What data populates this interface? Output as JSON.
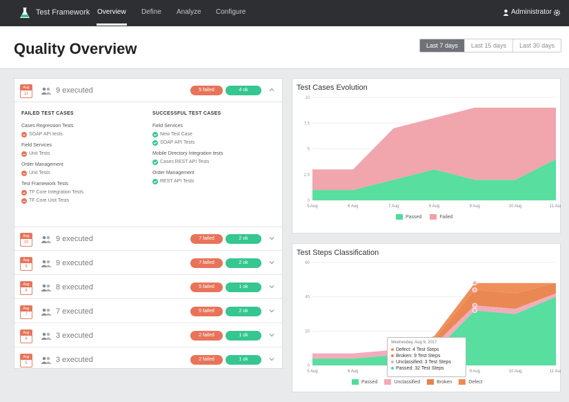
{
  "topbar": {
    "brand": "Test Framework",
    "nav": [
      "Overview",
      "Define",
      "Analyze",
      "Configure"
    ],
    "active_nav": "Overview",
    "user": "Administrator"
  },
  "header": {
    "title": "Quality Overview",
    "ranges": [
      "Last 7 days",
      "Last 15 days",
      "Last 30 days"
    ],
    "active_range": "Last 7 days"
  },
  "runs": [
    {
      "month": "Aug",
      "day": "11",
      "executed": "9 executed",
      "failed": "5 failed",
      "ok": "4 ok",
      "expanded": true
    },
    {
      "month": "Aug",
      "day": "10",
      "executed": "9 executed",
      "failed": "7 failed",
      "ok": "2 ok",
      "expanded": false
    },
    {
      "month": "Aug",
      "day": "9",
      "executed": "9 executed",
      "failed": "7 failed",
      "ok": "2 ok",
      "expanded": false
    },
    {
      "month": "Aug",
      "day": "8",
      "executed": "8 executed",
      "failed": "5 failed",
      "ok": "1 ok",
      "expanded": false
    },
    {
      "month": "Aug",
      "day": "7",
      "executed": "7 executed",
      "failed": "5 failed",
      "ok": "2 ok",
      "expanded": false
    },
    {
      "month": "Aug",
      "day": "6",
      "executed": "3 executed",
      "failed": "2 failed",
      "ok": "1 ok",
      "expanded": false
    },
    {
      "month": "Aug",
      "day": "5",
      "executed": "3 executed",
      "failed": "2 failed",
      "ok": "1 ok",
      "expanded": false
    }
  ],
  "details": {
    "failed_heading": "FAILED TEST CASES",
    "ok_heading": "SUCCESSFUL TEST CASES",
    "failed": [
      {
        "group": "Cases Regression Tests",
        "tests": [
          "SOAP API tests"
        ]
      },
      {
        "group": "Field Services",
        "tests": [
          "Unit Tests"
        ]
      },
      {
        "group": "Order Management",
        "tests": [
          "Unit Tests"
        ]
      },
      {
        "group": "Test Framework Tests",
        "tests": [
          "TF Core Integration Tests",
          "TF Core Unit Tests"
        ]
      }
    ],
    "ok": [
      {
        "group": "Field Services",
        "tests": [
          "New Test Case",
          "SOAP API Tests"
        ]
      },
      {
        "group": "Mobile Directory Integration tests",
        "tests": [
          "Cases REST API Tests"
        ]
      },
      {
        "group": "Order Management",
        "tests": [
          "REST API Tests"
        ]
      }
    ]
  },
  "colors": {
    "passed": "#4fdc9a",
    "failed": "#f0a0a8",
    "unclassified": "#f2a8b8",
    "broken": "#e8824a",
    "defect": "#ee8a52"
  },
  "chart_data": [
    {
      "type": "area",
      "title": "Test Cases Evolution",
      "categories": [
        "5 Aug",
        "6 Aug",
        "7 Aug",
        "8 Aug",
        "9 Aug",
        "10 Aug",
        "11 Aug"
      ],
      "ylim": [
        0,
        10
      ],
      "yticks": [
        "10",
        "7.5",
        "5",
        "2.5",
        "0"
      ],
      "stacked": true,
      "series": [
        {
          "name": "Passed",
          "values": [
            1,
            1,
            2,
            3,
            2,
            2,
            4
          ]
        },
        {
          "name": "Failed",
          "values": [
            2,
            2,
            5,
            5,
            7,
            7,
            5
          ]
        }
      ],
      "legend": "bottom"
    },
    {
      "type": "area",
      "title": "Test Steps Classification",
      "categories": [
        "5 Aug",
        "6 Aug",
        "7 Aug",
        "8 Aug",
        "9 Aug",
        "10 Aug",
        "11 Aug"
      ],
      "ylim": [
        0,
        60
      ],
      "yticks": [
        "60",
        "40",
        "20",
        "0"
      ],
      "stacked": true,
      "series": [
        {
          "name": "Passed",
          "values": [
            4,
            4,
            6,
            8,
            32,
            30,
            40
          ]
        },
        {
          "name": "Unclassified",
          "values": [
            3,
            3,
            3,
            4,
            3,
            3,
            2
          ]
        },
        {
          "name": "Broken",
          "values": [
            0,
            0,
            0,
            3,
            9,
            9,
            6
          ]
        },
        {
          "name": "Defect",
          "values": [
            0,
            0,
            0,
            2,
            4,
            6,
            0
          ]
        }
      ],
      "legend": "bottom",
      "tooltip": {
        "date": "Wednesday, Aug 9, 2017",
        "lines": [
          "Defect: 4 Test Steps",
          "Broken: 9 Test Steps",
          "Unclassified: 3 Test Steps",
          "Passed: 32 Test Steps"
        ]
      }
    }
  ]
}
